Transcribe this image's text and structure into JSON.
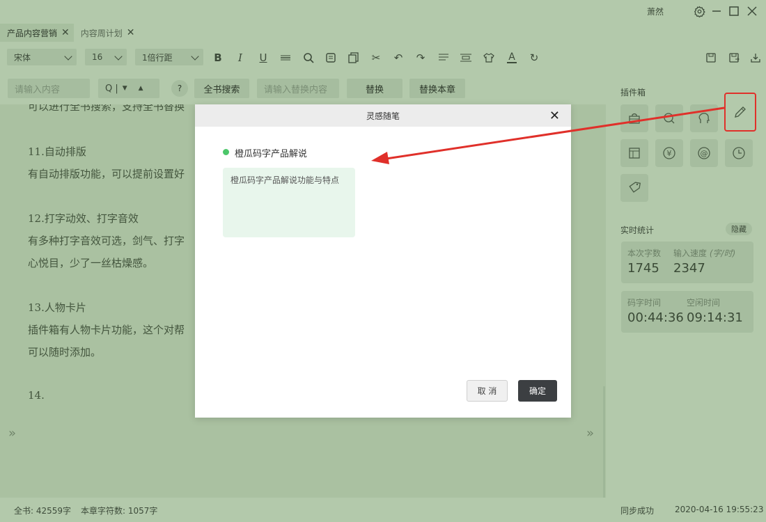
{
  "titlebar": {
    "user": "萧然"
  },
  "tabs": [
    {
      "label": "产品内容营销"
    },
    {
      "label": "内容周计划"
    }
  ],
  "format": {
    "font": "宋体",
    "size": "16",
    "line_spacing": "1倍行距"
  },
  "search": {
    "input_placeholder": "请输入内容",
    "mode_label": "Q |",
    "help": "?",
    "search_all": "全书搜索",
    "replace_placeholder": "请输入替换内容",
    "replace": "替换",
    "replace_chapter": "替换本章"
  },
  "editor": {
    "lines": [
      "可以进行全书搜索，支持全书替换",
      "11.自动排版",
      "有自动排版功能，可以提前设置好",
      "12.打字动效、打字音效",
      "有多种打字音效可选，剑气、打字",
      "心悦目，少了一丝枯燥感。",
      "13.人物卡片",
      "插件箱有人物卡片功能，这个对帮",
      "可以随时添加。",
      "14."
    ]
  },
  "panel": {
    "plugins_title": "插件箱",
    "stats_title": "实时统计",
    "hide": "隐藏",
    "stats": {
      "words_label": "本次字数",
      "words": "1745",
      "speed_label": "输入速度",
      "speed_unit": "(字/时)",
      "speed": "2347",
      "typing_time_label": "码字时间",
      "typing_time": "00:44:36",
      "idle_time_label": "空闲时间",
      "idle_time": "09:14:31"
    }
  },
  "statusbar": {
    "total": "全书: 42559字",
    "chapter": "本章字符数: 1057字",
    "sync": "同步成功",
    "datetime": "2020-04-16 19:55:23"
  },
  "modal": {
    "title": "灵感随笔",
    "category": "橙瓜码字产品解说",
    "note": "橙瓜码字产品解说功能与特点",
    "cancel": "取 消",
    "confirm": "确定"
  },
  "colors": {
    "background": "#b3c9ab",
    "annotation": "#e0302a",
    "dot": "#4cc76a",
    "confirm_btn": "#3c3f42"
  }
}
